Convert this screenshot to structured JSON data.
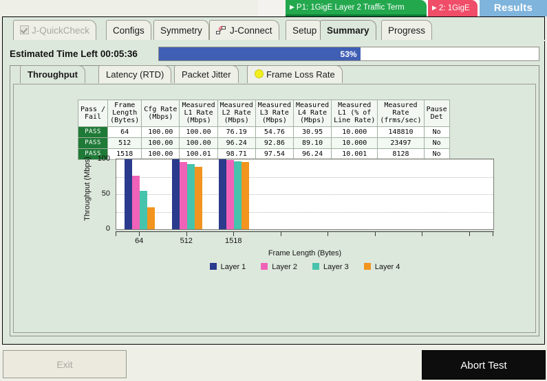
{
  "topbar": {
    "port_tab_active": "P1: 1GigE Layer 2 Traffic Term",
    "port_tab_second": "2: 1GigE",
    "results_label": "Results",
    "caret": "▶",
    "colors": {
      "active": "#23a84e",
      "second": "#ef4d68",
      "results": "#7fb4dd"
    }
  },
  "tabs": [
    {
      "label": "J-QuickCheck",
      "state": "disabled",
      "icon": "checkbox-checked-icon"
    },
    {
      "label": "Configs",
      "state": "normal"
    },
    {
      "label": "Symmetry",
      "state": "normal"
    },
    {
      "label": "J-Connect",
      "state": "normal",
      "icon": "j-connect-icon"
    },
    {
      "label": "Setup",
      "state": "normal"
    },
    {
      "label": "Summary",
      "state": "selected"
    },
    {
      "label": "Progress",
      "state": "normal"
    }
  ],
  "progress": {
    "label": "Estimated Time Left",
    "time_left": "00:05:36",
    "percent_label": "53%",
    "percent": 53,
    "fill_color": "#3f5fb5"
  },
  "subtabs": [
    {
      "label": "Throughput",
      "state": "selected"
    },
    {
      "label": "Latency (RTD)",
      "state": "normal"
    },
    {
      "label": "Packet Jitter",
      "state": "normal"
    },
    {
      "label": "Frame Loss Rate",
      "state": "normal",
      "icon": "yellow-status-dot-icon"
    }
  ],
  "table": {
    "headers": [
      "Pass /\nFail",
      "Frame\nLength\n(Bytes)",
      "Cfg Rate\n(Mbps)",
      "Measured\nL1 Rate\n(Mbps)",
      "Measured\nL2 Rate\n(Mbps)",
      "Measured\nL3 Rate\n(Mbps)",
      "Measured\nL4 Rate\n(Mbps)",
      "Measured\nL1 (% of\nLine Rate)",
      "Measured\nRate\n(frms/sec)",
      "Pause\nDet"
    ],
    "rows": [
      [
        "PASS",
        "64",
        "100.00",
        "100.00",
        "76.19",
        "54.76",
        "30.95",
        "10.000",
        "148810",
        "No"
      ],
      [
        "PASS",
        "512",
        "100.00",
        "100.00",
        "96.24",
        "92.86",
        "89.10",
        "10.000",
        "23497",
        "No"
      ],
      [
        "PASS",
        "1518",
        "100.00",
        "100.01",
        "98.71",
        "97.54",
        "96.24",
        "10.001",
        "8128",
        "No"
      ]
    ],
    "pass_color": "#1f7a37"
  },
  "chart_data": {
    "type": "bar",
    "title": "",
    "xlabel": "Frame Length (Bytes)",
    "ylabel": "Throughput (Mbps)",
    "categories": [
      "64",
      "512",
      "1518"
    ],
    "xtick_labels": [
      "64",
      "512",
      "1518",
      "",
      "",
      "",
      "",
      ""
    ],
    "xtick_count": 8,
    "ylim": [
      0,
      100
    ],
    "yticks": [
      0,
      50,
      100
    ],
    "ytick_labels": [
      "0",
      "50",
      "100"
    ],
    "yminor": [
      25,
      75
    ],
    "grid": true,
    "legend_position": "bottom",
    "series": [
      {
        "name": "Layer 1",
        "color": "#2a3a8c",
        "values": [
          100.0,
          100.0,
          100.01
        ]
      },
      {
        "name": "Layer 2",
        "color": "#f062b8",
        "values": [
          76.19,
          96.24,
          98.71
        ]
      },
      {
        "name": "Layer 3",
        "color": "#46c3ac",
        "values": [
          54.76,
          92.86,
          97.54
        ]
      },
      {
        "name": "Layer 4",
        "color": "#f2941e",
        "values": [
          30.95,
          89.1,
          96.24
        ]
      }
    ]
  },
  "buttons": {
    "exit": "Exit",
    "abort": "Abort Test"
  }
}
